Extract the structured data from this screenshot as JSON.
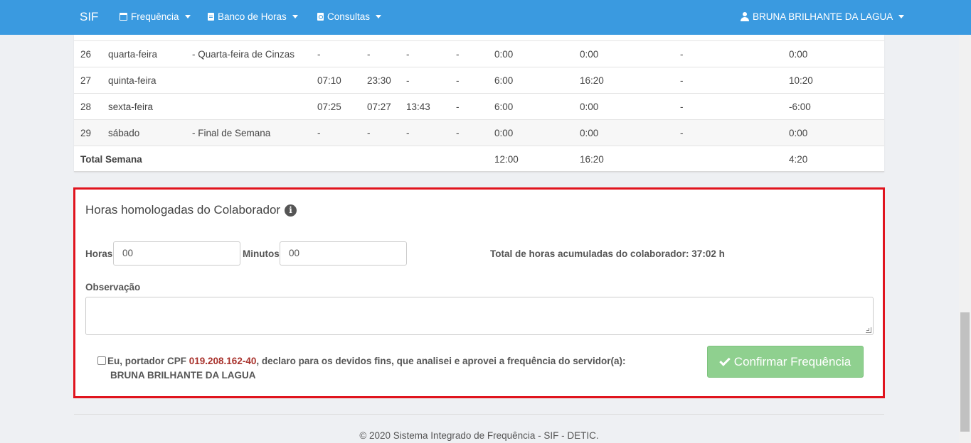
{
  "navbar": {
    "brand": "SIF",
    "menu_frequencia": "Frequência",
    "menu_banco": "Banco de Horas",
    "menu_consultas": "Consultas",
    "user_name": "BRUNA BRILHANTE DA LAGUA",
    "color": "#3a9ae0"
  },
  "table": {
    "rows": [
      {
        "day": "26",
        "weekday": "quarta-feira",
        "note": "- Quarta-feira de Cinzas",
        "e1": "-",
        "s1": "-",
        "e2": "-",
        "s2": "-",
        "previstas": "0:00",
        "trabalhadas": "0:00",
        "abono": "-",
        "saldo": "0:00"
      },
      {
        "day": "27",
        "weekday": "quinta-feira",
        "note": "",
        "e1": "07:10",
        "s1": "23:30",
        "e2": "-",
        "s2": "-",
        "previstas": "6:00",
        "trabalhadas": "16:20",
        "abono": "-",
        "saldo": "10:20"
      },
      {
        "day": "28",
        "weekday": "sexta-feira",
        "note": "",
        "e1": "07:25",
        "s1": "07:27",
        "e2": "13:43",
        "s2": "-",
        "previstas": "6:00",
        "trabalhadas": "0:00",
        "abono": "-",
        "saldo": "-6:00"
      },
      {
        "day": "29",
        "weekday": "sábado",
        "note": "- Final de Semana",
        "e1": "-",
        "s1": "-",
        "e2": "-",
        "s2": "-",
        "previstas": "0:00",
        "trabalhadas": "0:00",
        "abono": "-",
        "saldo": "0:00"
      }
    ],
    "total": {
      "label": "Total Semana",
      "previstas": "12:00",
      "trabalhadas": "16:20",
      "saldo": "4:20"
    }
  },
  "homologacao": {
    "title": "Horas homologadas do Colaborador",
    "horas_label": "Horas",
    "horas_value": "00",
    "minutos_label": "Minutos",
    "minutos_value": "00",
    "total_acumulado": "Total de horas acumuladas do colaborador: 37:02 h",
    "observacao_label": "Observação",
    "observacao_value": "",
    "declaracao_prefix": "Eu, portador CPF ",
    "cpf": "019.208.162-40",
    "declaracao_suffix": ", declaro para os devidos fins, que analisei e aprovei a frequência do servidor(a):",
    "servidor": "BRUNA BRILHANTE DA LAGUA",
    "confirm_label": "Confirmar Frequência",
    "highlight_color": "#e0141e"
  },
  "footer": {
    "text": "© 2020 Sistema Integrado de Frequência - SIF - DETIC."
  }
}
